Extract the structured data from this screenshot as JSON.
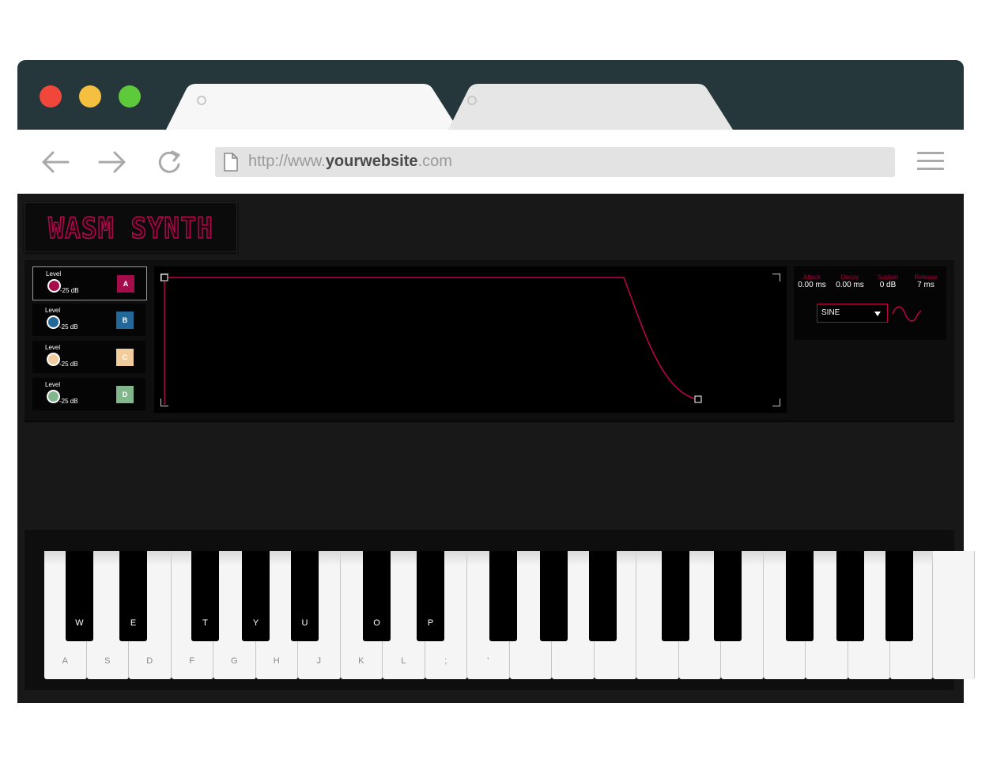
{
  "browser": {
    "url_prefix": "http://www.",
    "url_domain": "yourwebsite",
    "url_suffix": ".com",
    "tab_count": 2,
    "icons": [
      "close-icon",
      "back-arrow-icon",
      "forward-arrow-icon",
      "reload-icon",
      "page-icon",
      "hamburger-menu-icon"
    ],
    "colors": {
      "close": "#f1473a",
      "minimize": "#f5bf3f",
      "maximize": "#5fc93c",
      "titlebar": "#25373b"
    }
  },
  "app": {
    "logo_text": "WASM SYNTH",
    "accent_color": "#c4004a"
  },
  "oscillators": [
    {
      "level_label": "Level",
      "level_value": "-25 dB",
      "badge": "A",
      "color": "#a50d4a",
      "selected": true
    },
    {
      "level_label": "Level",
      "level_value": "-25 dB",
      "badge": "B",
      "color": "#22699a",
      "selected": false
    },
    {
      "level_label": "Level",
      "level_value": "-25 dB",
      "badge": "C",
      "color": "#f1cc9d",
      "selected": false
    },
    {
      "level_label": "Level",
      "level_value": "-25 dB",
      "badge": "D",
      "color": "#82b68c",
      "selected": false
    }
  ],
  "envelope": {
    "attack_label": "Attack",
    "attack_value": "0.00 ms",
    "decay_label": "Decay",
    "decay_value": "0.00 ms",
    "sustain_label": "Sustain",
    "sustain_value": "0 dB",
    "release_label": "Release",
    "release_value": "7 ms",
    "waveform": "SINE",
    "waveform_icon": "sine-wave-icon"
  },
  "keyboard": {
    "white_labels": [
      "A",
      "S",
      "D",
      "F",
      "G",
      "H",
      "J",
      "K",
      "L",
      ";",
      "'",
      "",
      "",
      "",
      "",
      "",
      "",
      "",
      "",
      "",
      "",
      ""
    ],
    "black_labels": [
      "W",
      "E",
      "T",
      "Y",
      "U",
      "O",
      "P",
      "",
      "",
      "",
      "",
      "",
      "",
      "",
      ""
    ]
  }
}
